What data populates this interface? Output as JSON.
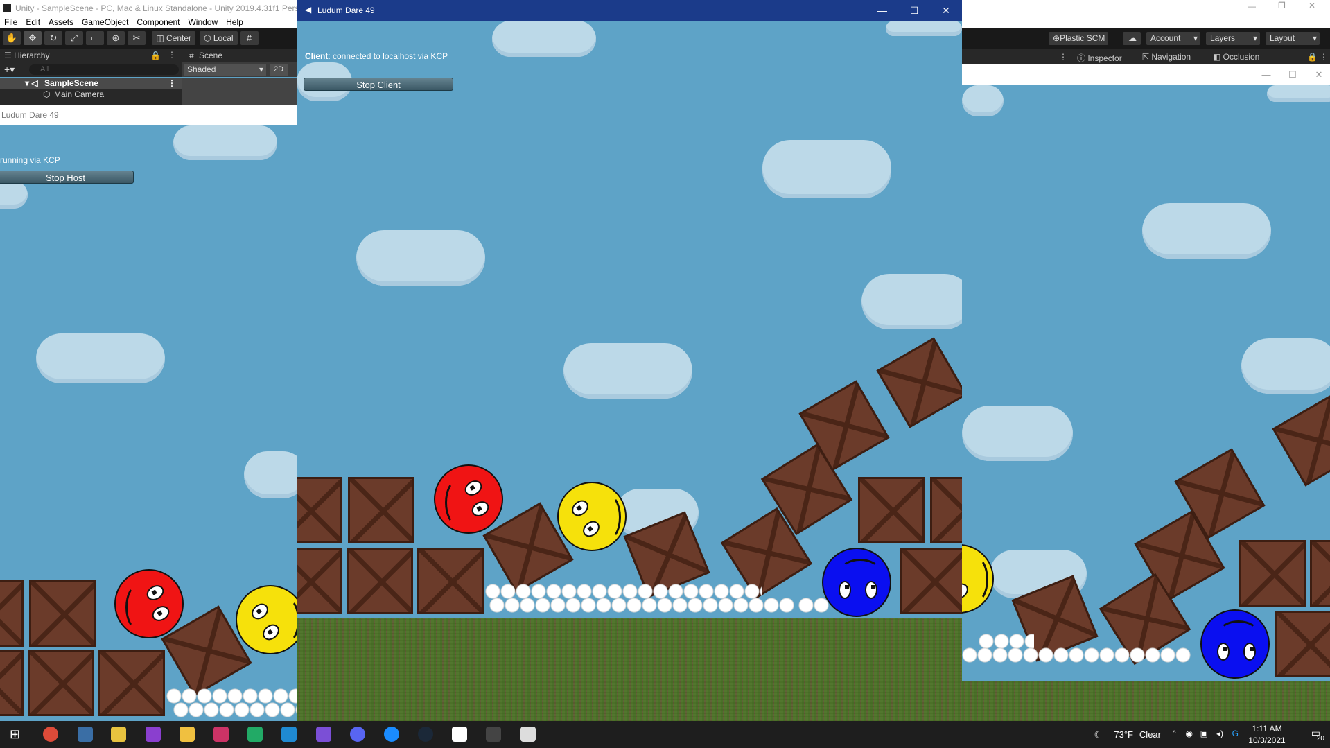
{
  "unity": {
    "title": "Unity - SampleScene - PC, Mac & Linux Standalone - Unity 2019.4.31f1 Perso",
    "menu": [
      "File",
      "Edit",
      "Assets",
      "GameObject",
      "Component",
      "Window",
      "Help"
    ],
    "toolbar": {
      "center_label": "Center",
      "local_label": "Local",
      "plastic_label": "Plastic SCM",
      "account_label": "Account",
      "layers_label": "Layers",
      "layout_label": "Layout"
    },
    "hierarchy": {
      "tab_label": "Hierarchy",
      "search_placeholder": "All",
      "scene_name": "SampleScene",
      "items": [
        "Main Camera"
      ]
    },
    "scene": {
      "tab_label": "Scene",
      "shading_mode": "Shaded",
      "mode_2d": "2D"
    },
    "right_tabs": {
      "inspector": "Inspector",
      "navigation": "Navigation",
      "occlusion": "Occlusion"
    }
  },
  "host_window": {
    "title": "Ludum Dare 49",
    "status_text": "running via KCP",
    "stop_button_label": "Stop Host"
  },
  "client_window": {
    "title": "Ludum Dare 49",
    "status_label": "Client",
    "status_text": ": connected to localhost via KCP",
    "stop_button_label": "Stop Client"
  },
  "taskbar": {
    "weather_temp": "73°F",
    "weather_text": "Clear",
    "time": "1:11 AM",
    "date": "10/3/2021",
    "notification_count": "20",
    "apps": [
      "windows-start",
      "chrome",
      "task-view",
      "file-explorer-2",
      "visual-studio",
      "file-explorer",
      "rider",
      "datagrip",
      "vscode",
      "obsidian",
      "discord",
      "1password",
      "steam",
      "twitch",
      "unity-hub",
      "unity"
    ]
  },
  "colors": {
    "sky": "#5ea3c7",
    "client_titlebar": "#1b3b8a",
    "red_ball": "#f01414",
    "yellow_ball": "#f6e10b",
    "blue_ball": "#0a0ff0",
    "crate": "#6b3b2a"
  }
}
